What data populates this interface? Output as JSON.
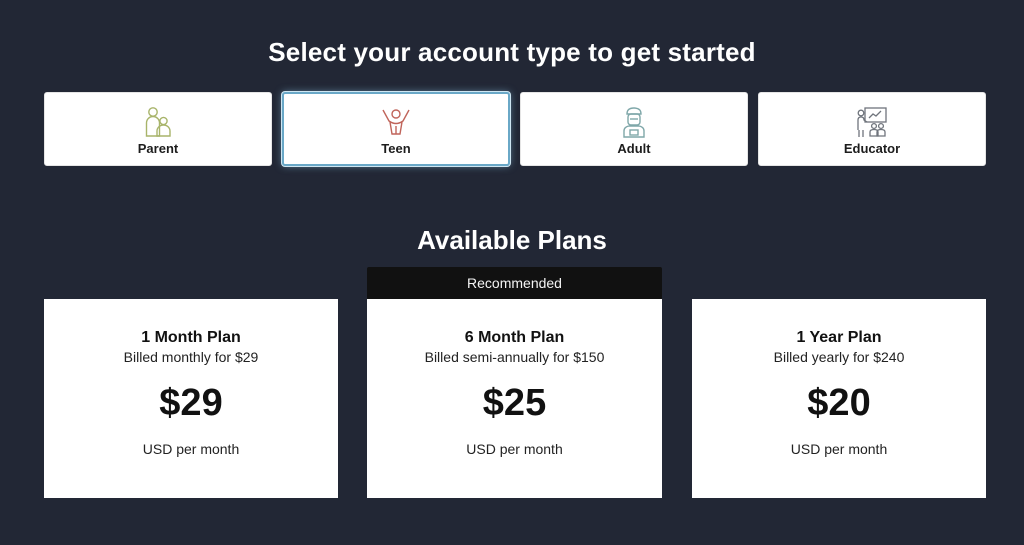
{
  "header": {
    "title": "Select your account type to get started"
  },
  "account_types": [
    {
      "label": "Parent",
      "icon": "parent-icon",
      "selected": false,
      "color": "#a8b46a"
    },
    {
      "label": "Teen",
      "icon": "teen-icon",
      "selected": true,
      "color": "#c0645a"
    },
    {
      "label": "Adult",
      "icon": "adult-icon",
      "selected": false,
      "color": "#7fa7a9"
    },
    {
      "label": "Educator",
      "icon": "educator-icon",
      "selected": false,
      "color": "#7a7f86"
    }
  ],
  "plans_section": {
    "title": "Available Plans",
    "recommended_label": "Recommended"
  },
  "plans": [
    {
      "name": "1 Month Plan",
      "billing": "Billed monthly for $29",
      "price": "$29",
      "unit": "USD per month",
      "recommended": false
    },
    {
      "name": "6 Month Plan",
      "billing": "Billed semi-annually for $150",
      "price": "$25",
      "unit": "USD per month",
      "recommended": true
    },
    {
      "name": "1 Year Plan",
      "billing": "Billed yearly for $240",
      "price": "$20",
      "unit": "USD per month",
      "recommended": false
    }
  ],
  "colors": {
    "background": "#222735",
    "selected_border": "#6aa8c7",
    "banner": "#111111"
  }
}
